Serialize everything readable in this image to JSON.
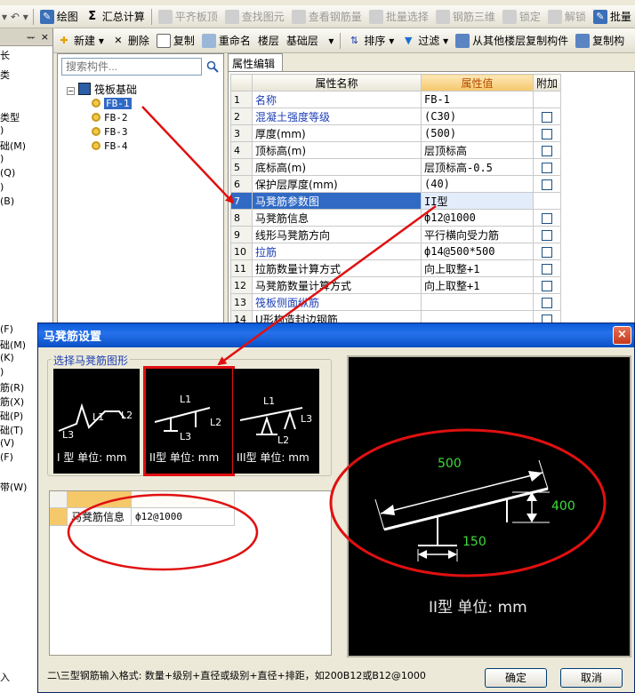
{
  "toolbar1": {
    "items": [
      {
        "label": "绘图",
        "icon": "draw-icon",
        "disabled": false
      },
      {
        "label": "汇总计算",
        "icon": "sigma-icon",
        "disabled": false
      },
      {
        "label": "平齐板顶",
        "icon": "align-top-icon",
        "disabled": true
      },
      {
        "label": "查找图元",
        "icon": "find-icon",
        "disabled": true
      },
      {
        "label": "查看钢筋量",
        "icon": "view-rebar-icon",
        "disabled": true
      },
      {
        "label": "批量选择",
        "icon": "batch-select-icon",
        "disabled": true
      },
      {
        "label": "钢筋三维",
        "icon": "rebar-3d-icon",
        "disabled": true
      },
      {
        "label": "锁定",
        "icon": "lock-icon",
        "disabled": true
      },
      {
        "label": "解锁",
        "icon": "unlock-icon",
        "disabled": true
      },
      {
        "label": "批量",
        "icon": "batch-icon",
        "disabled": false
      }
    ],
    "sigma": "Σ"
  },
  "toolbar2": {
    "new": "新建",
    "delete": "删除",
    "copy": "复制",
    "rename": "重命名",
    "floor": "楼层",
    "floor_value": "基础层",
    "sort": "排序",
    "filter": "过滤",
    "copy_from_floor": "从其他楼层复制构件",
    "copy_to": "复制构"
  },
  "left_pane": {
    "pin": "ᅲ",
    "close": "×",
    "items": [
      "长",
      "类",
      "类型",
      ")",
      "础(M)",
      ")",
      "(Q)",
      ")",
      "(B)",
      "(F)",
      "础(M)",
      "(K)",
      ")",
      "筋(R)",
      "筋(X)",
      "础(P)",
      "础(T)",
      "(V)",
      "(F)",
      "带(W)",
      "入"
    ]
  },
  "tree": {
    "search_placeholder": "搜索构件...",
    "root": "筏板基础",
    "children": [
      "FB-1",
      "FB-2",
      "FB-3",
      "FB-4"
    ]
  },
  "props": {
    "tab": "属性编辑",
    "headers": [
      "属性名称",
      "属性值",
      "附加"
    ],
    "rows": [
      {
        "n": "1",
        "name": "名称",
        "value": "FB-1",
        "blue": true,
        "cb": false
      },
      {
        "n": "2",
        "name": "混凝土强度等级",
        "value": "(C30)",
        "blue": true,
        "cb": true
      },
      {
        "n": "3",
        "name": "厚度(mm)",
        "value": "(500)",
        "blue": false,
        "cb": true
      },
      {
        "n": "4",
        "name": "顶标高(m)",
        "value": "层顶标高",
        "blue": false,
        "cb": true
      },
      {
        "n": "5",
        "name": "底标高(m)",
        "value": "层顶标高-0.5",
        "blue": false,
        "cb": true
      },
      {
        "n": "6",
        "name": "保护层厚度(mm)",
        "value": "(40)",
        "blue": false,
        "cb": true
      },
      {
        "n": "7",
        "name": "马凳筋参数图",
        "value": "II型",
        "blue": false,
        "cb": false,
        "selected": true
      },
      {
        "n": "8",
        "name": "马凳筋信息",
        "value": "ф12@1000",
        "blue": false,
        "cb": true
      },
      {
        "n": "9",
        "name": "线形马凳筋方向",
        "value": "平行横向受力筋",
        "blue": false,
        "cb": true
      },
      {
        "n": "10",
        "name": "拉筋",
        "value": "ф14@500*500",
        "blue": true,
        "cb": true
      },
      {
        "n": "11",
        "name": "拉筋数量计算方式",
        "value": "向上取整+1",
        "blue": false,
        "cb": true
      },
      {
        "n": "12",
        "name": "马凳筋数量计算方式",
        "value": "向上取整+1",
        "blue": false,
        "cb": true
      },
      {
        "n": "13",
        "name": "筏板侧面纵筋",
        "value": "",
        "blue": true,
        "cb": true
      },
      {
        "n": "14",
        "name": "U形构造封边钢筋",
        "value": "",
        "blue": false,
        "cb": true
      }
    ]
  },
  "dialog": {
    "title": "马凳筋设置",
    "close": "×",
    "group_label": "选择马凳筋图形",
    "shapes": [
      {
        "caption": "I 型 单位: mm",
        "labels": [
          "L1",
          "L2",
          "L3"
        ]
      },
      {
        "caption": "II型 单位: mm",
        "labels": [
          "L1",
          "L2",
          "L3"
        ]
      },
      {
        "caption": "III型 单位: mm",
        "labels": [
          "L1",
          "L3",
          "L2"
        ]
      }
    ],
    "info_label": "马凳筋信息",
    "info_value": "ф12@1000",
    "preview": {
      "l1": "500",
      "l2": "400",
      "l3": "150",
      "caption": "II型 单位: mm"
    },
    "hint": "二\\三型钢筋输入格式: 数量+级别+直径或级别+直径+排距，如200B12或B12@1000",
    "ok": "确定",
    "cancel": "取消"
  },
  "colors": {
    "annotation": "#e01010",
    "titlebar": "#0b5ad8",
    "value_header": "#f5c86a"
  }
}
